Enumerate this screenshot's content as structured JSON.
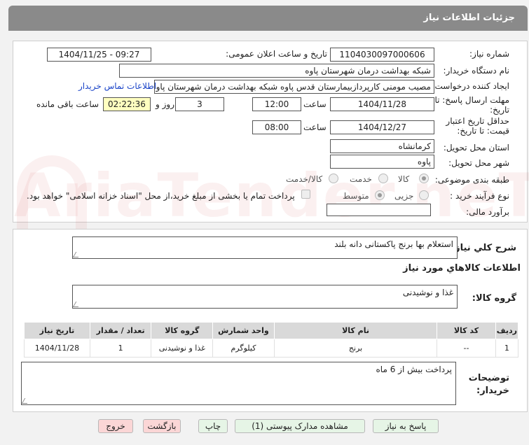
{
  "page_title": "جزئیات اطلاعات نیاز",
  "fields": {
    "need_number_label": "شماره نیاز:",
    "need_number": "1104030097000606",
    "announce_label": "تاریخ و ساعت اعلان عمومی:",
    "announce_value": "1404/11/25 - 09:27",
    "buyer_org_label": "نام دستگاه خریدار:",
    "buyer_org": "شبکه بهداشت درمان شهرستان پاوه",
    "creator_label": "ایجاد کننده درخواست:",
    "creator": "مصیب مومنی کارپردازبیمارستان قدس پاوه شبکه بهداشت درمان شهرستان پاوه",
    "contact_link": "اطلاعات تماس خریدار",
    "deadline_label": "مهلت ارسال پاسخ: تا تاریخ:",
    "deadline_date": "1404/11/28",
    "time_label": "ساعت",
    "deadline_time": "12:00",
    "days": "3",
    "days_and": "روز و",
    "remaining_time": "02:22:36",
    "remaining_label": "ساعت باقی مانده",
    "validity_label": "حداقل تاریخ اعتبار قیمت: تا تاریخ:",
    "validity_date": "1404/12/27",
    "validity_time": "08:00",
    "province_label": "استان محل تحویل:",
    "province": "کرمانشاه",
    "city_label": "شهر محل تحویل:",
    "city": "پاوه",
    "category_label": "طبقه بندی موضوعی:",
    "cat_goods": "کالا",
    "cat_service": "خدمت",
    "cat_goods_service": "کالا/خدمت",
    "process_label": "نوع فرآیند خرید :",
    "proc_minor": "جزیی",
    "proc_medium": "متوسط",
    "payment_note": "پرداخت تمام یا بخشی از مبلغ خرید،از محل \"اسناد خزانه اسلامی\" خواهد بود.",
    "estimate_label": "برآورد مالی:",
    "estimate_value": ""
  },
  "summary": {
    "label": "شرح کلي نياز:",
    "value": "استعلام بها برنج پاکستانی دانه بلند"
  },
  "items_section": {
    "title": "اطلاعات کالاهاي مورد نياز",
    "group_label": "گروه کالا:",
    "group_value": "غذا و نوشیدنی"
  },
  "table": {
    "headers": [
      "ردیف",
      "کد کالا",
      "نام کالا",
      "واحد شمارش",
      "گروه کالا",
      "تعداد / مقدار",
      "تاریخ نیاز"
    ],
    "rows": [
      [
        "1",
        "--",
        "برنج",
        "کیلوگرم",
        "غذا و نوشیدنی",
        "1",
        "1404/11/28"
      ]
    ]
  },
  "buyer_notes": {
    "label": "توضیحات خریدار:",
    "value": "پرداخت بیش از 6 ماه"
  },
  "buttons": {
    "reply": "پاسخ به نیاز",
    "attachments": "مشاهده مدارک پیوستی (1)",
    "print": "چاپ",
    "back": "بازگشت",
    "exit": "خروج"
  },
  "watermark": "AriaTender.neT",
  "colors": {
    "title_bar": "#8a8a8a",
    "link": "#1a44c8",
    "remaining_bg": "#ffffc0",
    "button_green": "#e6f5e6",
    "button_pink": "#fbd6d6"
  }
}
